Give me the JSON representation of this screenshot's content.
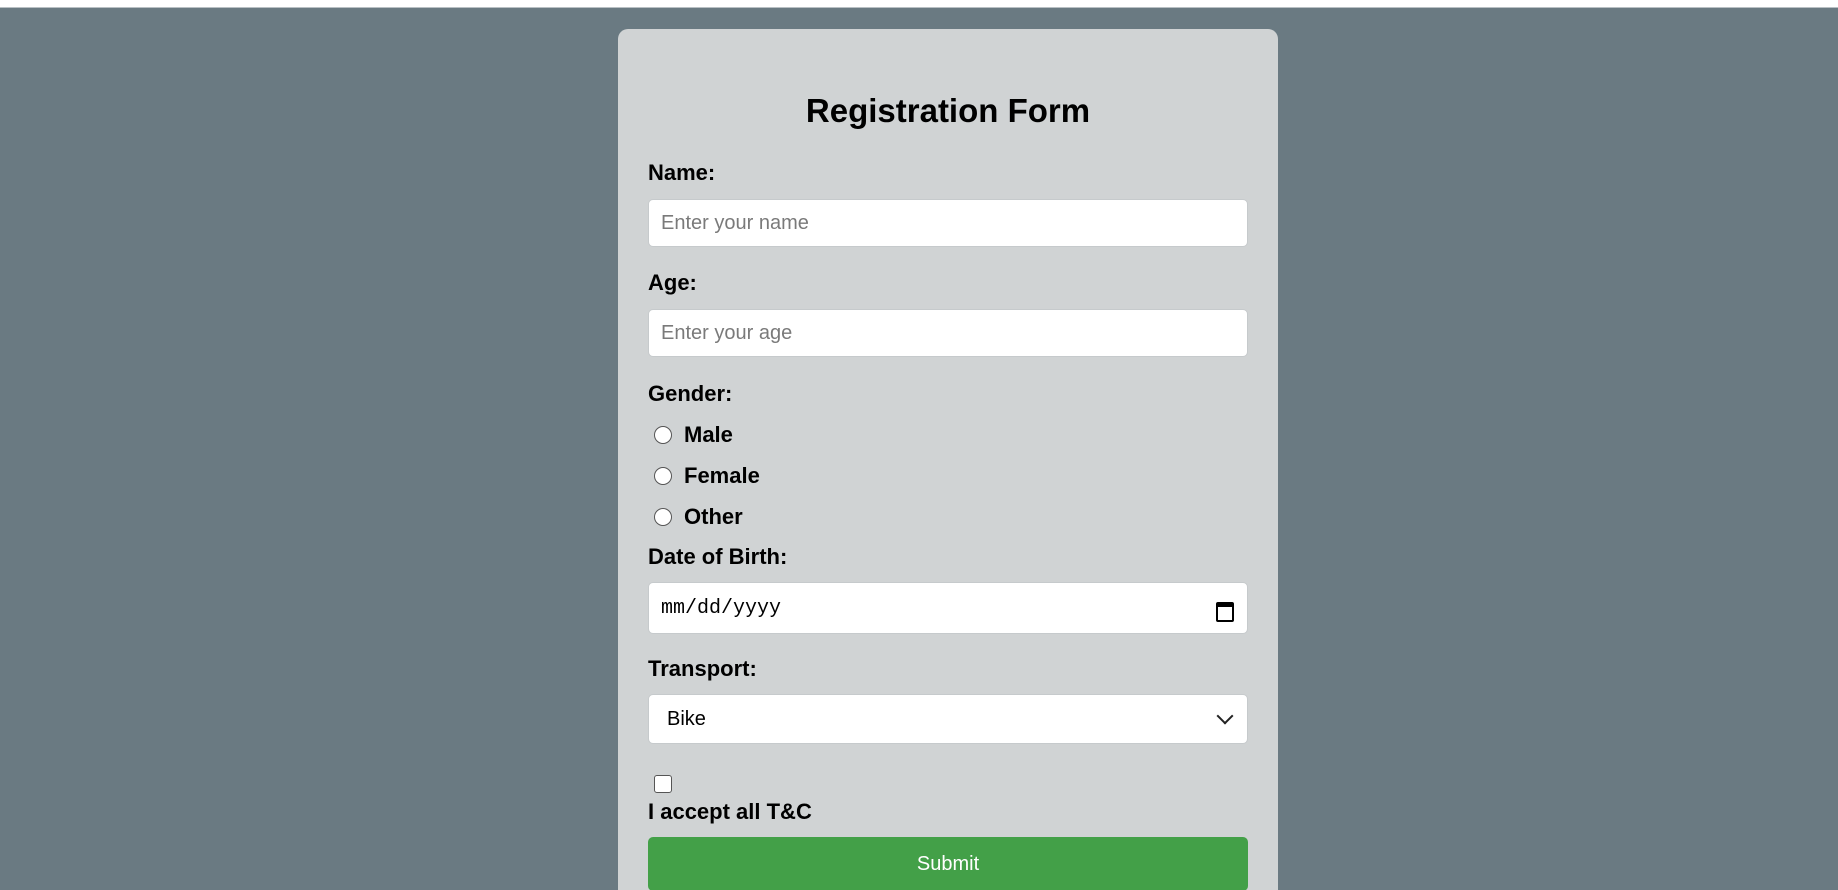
{
  "form": {
    "title": "Registration Form",
    "name": {
      "label": "Name:",
      "placeholder": "Enter your name",
      "value": ""
    },
    "age": {
      "label": "Age:",
      "placeholder": "Enter your age",
      "value": ""
    },
    "gender": {
      "label": "Gender:",
      "options": [
        {
          "label": "Male",
          "selected": false
        },
        {
          "label": "Female",
          "selected": false
        },
        {
          "label": "Other",
          "selected": false
        }
      ]
    },
    "dob": {
      "label": "Date of Birth:",
      "placeholder": "mm/dd/yyyy",
      "icon": "calendar-icon"
    },
    "transport": {
      "label": "Transport:",
      "selected": "Bike",
      "icon": "chevron-down-icon"
    },
    "terms": {
      "label": "I accept all T&C",
      "checked": false
    },
    "submit_label": "Submit"
  },
  "colors": {
    "background": "#6a7a82",
    "card": "#d0d3d4",
    "submit": "#43a048"
  }
}
